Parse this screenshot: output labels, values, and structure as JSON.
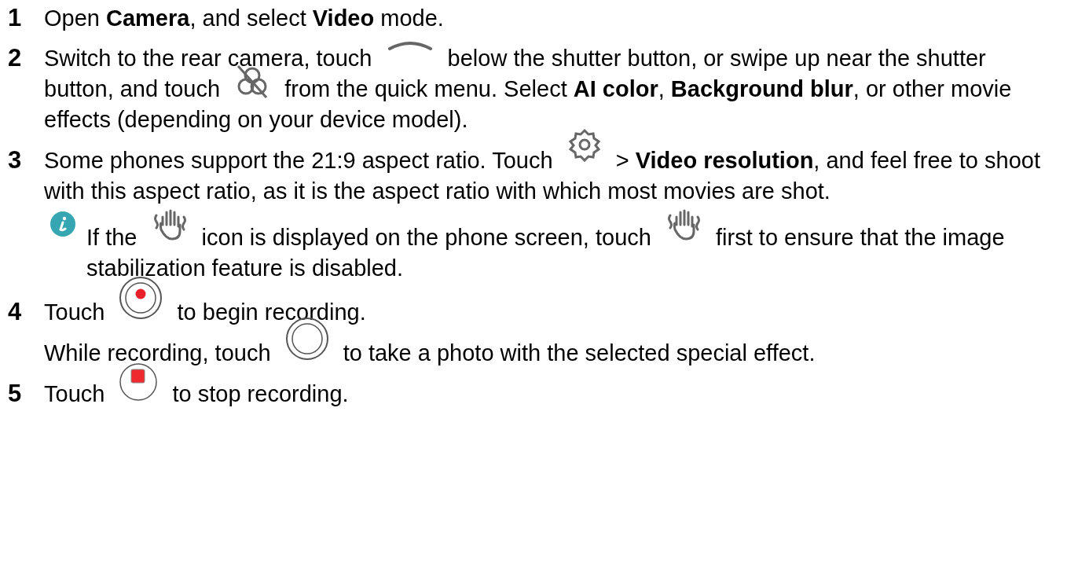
{
  "steps": [
    {
      "number": "1",
      "paragraphs": [
        {
          "kind": "text",
          "parts": [
            {
              "kind": "text",
              "text": "Open **Camera**, and select **Video** mode."
            }
          ]
        }
      ]
    },
    {
      "number": "2",
      "paragraphs": [
        {
          "kind": "text",
          "parts": [
            {
              "kind": "text",
              "text": "Switch to the rear camera, touch"
            },
            {
              "kind": "icon"
            },
            {
              "kind": "text",
              "text": "below the shutter button, or swipe up near the shutter button, and touch"
            },
            {
              "kind": "icon"
            },
            {
              "kind": "text",
              "text": "from the quick menu. Select **AI color**, **Background blur**, or other movie effects (depending on your device model)."
            }
          ]
        }
      ]
    },
    {
      "number": "3",
      "paragraphs": [
        {
          "kind": "text",
          "parts": [
            {
              "kind": "text",
              "text": "Some phones support the 21:9 aspect ratio. Touch"
            },
            {
              "kind": "icon"
            },
            {
              "kind": "text",
              "text": "> **Video resolution**, and feel free to shoot with this aspect ratio, as it is the aspect ratio with which most movies are shot."
            }
          ]
        },
        {
          "kind": "note",
          "parts": [
            {
              "kind": "text",
              "text": "If the"
            },
            {
              "kind": "icon"
            },
            {
              "kind": "text",
              "text": "icon is displayed on the phone screen, touch"
            },
            {
              "kind": "icon"
            },
            {
              "kind": "text",
              "text": "first to ensure that the image stabilization feature is disabled."
            }
          ]
        }
      ]
    },
    {
      "number": "4",
      "paragraphs": [
        {
          "kind": "text",
          "parts": [
            {
              "kind": "text",
              "text": "Touch"
            },
            {
              "kind": "icon"
            },
            {
              "kind": "text",
              "text": "to begin recording."
            }
          ]
        },
        {
          "kind": "text",
          "parts": [
            {
              "kind": "text",
              "text": "While recording, touch"
            },
            {
              "kind": "icon"
            },
            {
              "kind": "text",
              "text": "to take a photo with the selected special effect."
            }
          ]
        }
      ]
    },
    {
      "number": "5",
      "paragraphs": [
        {
          "kind": "text",
          "parts": [
            {
              "kind": "text",
              "text": "Touch"
            },
            {
              "kind": "icon"
            },
            {
              "kind": "text",
              "text": "to stop recording."
            }
          ]
        }
      ]
    }
  ]
}
